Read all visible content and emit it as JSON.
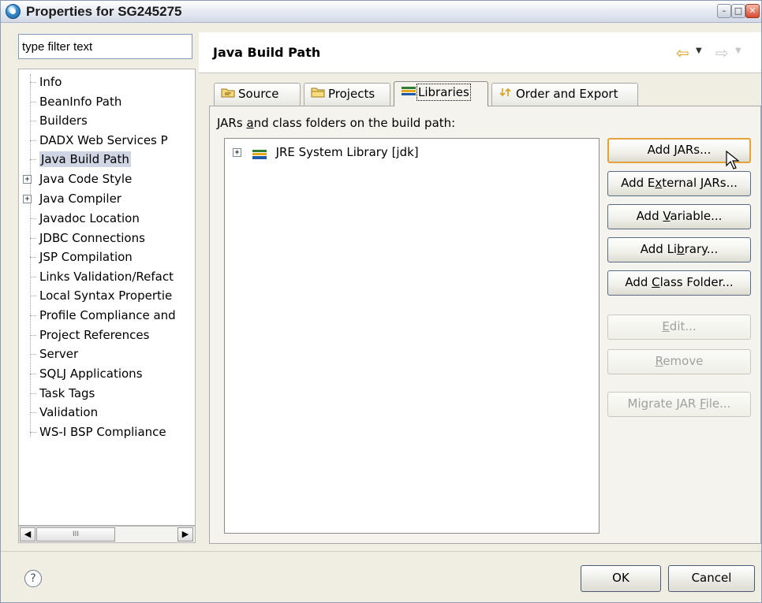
{
  "window": {
    "title": "Properties for SG245275",
    "min_glyph": "–",
    "max_glyph": "□",
    "close_glyph": "✕"
  },
  "filter": {
    "placeholder": "type filter text"
  },
  "tree": {
    "items": [
      {
        "label": "Info"
      },
      {
        "label": "BeanInfo Path"
      },
      {
        "label": "Builders"
      },
      {
        "label": "DADX Web Services P"
      },
      {
        "label": "Java Build Path",
        "selected": true
      },
      {
        "label": "Java Code Style",
        "expandable": true
      },
      {
        "label": "Java Compiler",
        "expandable": true
      },
      {
        "label": "Javadoc Location"
      },
      {
        "label": "JDBC Connections"
      },
      {
        "label": "JSP Compilation"
      },
      {
        "label": "Links Validation/Refact"
      },
      {
        "label": "Local Syntax Propertie"
      },
      {
        "label": "Profile Compliance and"
      },
      {
        "label": "Project References"
      },
      {
        "label": "Server"
      },
      {
        "label": "SQLJ Applications"
      },
      {
        "label": "Task Tags"
      },
      {
        "label": "Validation"
      },
      {
        "label": "WS-I BSP Compliance"
      }
    ],
    "scroll_thumb_glyph": "III"
  },
  "page": {
    "title": "Java Build Path",
    "nav_back_icon": "back-arrow-icon",
    "nav_forward_icon": "forward-arrow-icon"
  },
  "tabs": [
    {
      "label": "Source",
      "icon": "source-folder-icon"
    },
    {
      "label": "Projects",
      "icon": "projects-folder-icon"
    },
    {
      "label": "Libraries",
      "icon": "library-icon",
      "active": true
    },
    {
      "label": "Order and Export",
      "icon": "order-export-icon"
    }
  ],
  "libraries": {
    "label_pre": "JARs ",
    "label_mnemonic": "a",
    "label_post": "nd class folders on the build path:",
    "entries": [
      {
        "label": "JRE System Library [jdk]",
        "icon": "library-icon"
      }
    ]
  },
  "buttons": {
    "add_jars": {
      "pre": "Add ",
      "mn": "J",
      "post": "ARs..."
    },
    "add_external_jars": {
      "pre": "Add E",
      "mn": "x",
      "post": "ternal JARs..."
    },
    "add_variable": {
      "pre": "Add ",
      "mn": "V",
      "post": "ariable..."
    },
    "add_library": {
      "pre": "Add Li",
      "mn": "b",
      "post": "rary..."
    },
    "add_class_folder": {
      "pre": "Add ",
      "mn": "C",
      "post": "lass Folder..."
    },
    "edit": {
      "pre": "",
      "mn": "E",
      "post": "dit..."
    },
    "remove": {
      "pre": "",
      "mn": "R",
      "post": "emove"
    },
    "migrate_jar": {
      "pre": "Migrate JAR ",
      "mn": "F",
      "post": "ile..."
    }
  },
  "footer": {
    "help_glyph": "?",
    "ok": "OK",
    "cancel": "Cancel"
  },
  "colors": {
    "default_button_border": "#e3a23b",
    "selection": "#cfd5e3",
    "back_arrow": "#d8a21a"
  }
}
